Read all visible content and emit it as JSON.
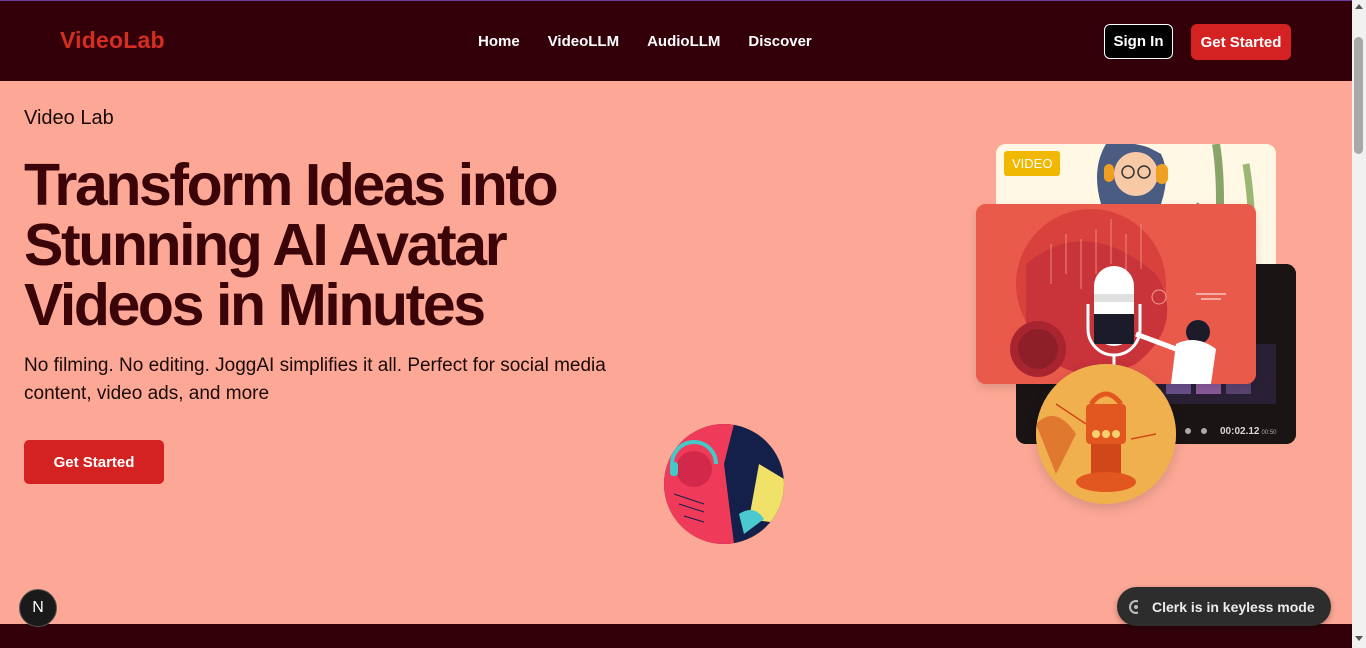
{
  "nav": {
    "logo": "VideoLab",
    "links": [
      "Home",
      "VideoLLM",
      "AudioLLM",
      "Discover"
    ],
    "sign_in": "Sign In",
    "get_started": "Get Started"
  },
  "hero": {
    "eyebrow": "Video Lab",
    "title_lines": [
      "Transform Ideas into",
      "Stunning AI Avatar",
      "Videos in Minutes"
    ],
    "subtitle": "No filming. No editing. JoggAI simplifies it all. Perfect for social media content, video ads, and more",
    "cta": "Get Started"
  },
  "cards": {
    "video_badge": "VIDEO",
    "timecode": "00:02.12",
    "timecode_total": "00:50"
  },
  "overlay": {
    "n_badge": "N",
    "clerk": "Clerk is in keyless mode"
  },
  "colors": {
    "hero_bg": "#fda896",
    "nav_bg": "#33000a",
    "accent": "#d42222",
    "title": "#3a0408"
  },
  "icons": [
    "clerk-icon",
    "nextjs-icon"
  ]
}
